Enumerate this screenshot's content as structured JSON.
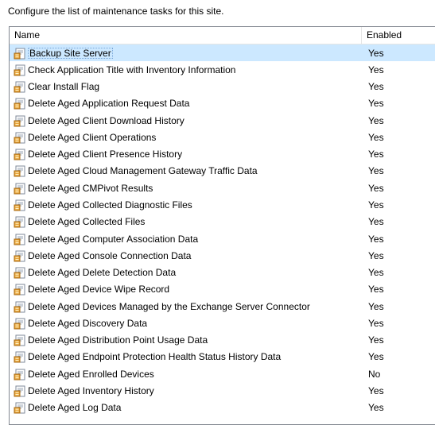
{
  "instruction": "Configure the list of maintenance tasks for this site.",
  "columns": {
    "name": "Name",
    "enabled": "Enabled"
  },
  "tasks": [
    {
      "name": "Backup Site Server",
      "enabled": "Yes",
      "selected": true
    },
    {
      "name": "Check Application Title with Inventory Information",
      "enabled": "Yes"
    },
    {
      "name": "Clear Install Flag",
      "enabled": "Yes"
    },
    {
      "name": "Delete Aged Application Request Data",
      "enabled": "Yes"
    },
    {
      "name": "Delete Aged Client Download History",
      "enabled": "Yes"
    },
    {
      "name": "Delete Aged Client Operations",
      "enabled": "Yes"
    },
    {
      "name": "Delete Aged Client Presence History",
      "enabled": "Yes"
    },
    {
      "name": "Delete Aged Cloud Management Gateway Traffic Data",
      "enabled": "Yes"
    },
    {
      "name": "Delete Aged CMPivot Results",
      "enabled": "Yes"
    },
    {
      "name": "Delete Aged Collected Diagnostic Files",
      "enabled": "Yes"
    },
    {
      "name": "Delete Aged Collected Files",
      "enabled": "Yes"
    },
    {
      "name": "Delete Aged Computer Association Data",
      "enabled": "Yes"
    },
    {
      "name": "Delete Aged Console Connection Data",
      "enabled": "Yes"
    },
    {
      "name": "Delete Aged Delete Detection Data",
      "enabled": "Yes"
    },
    {
      "name": "Delete Aged Device Wipe Record",
      "enabled": "Yes"
    },
    {
      "name": "Delete Aged Devices Managed by the Exchange Server Connector",
      "enabled": "Yes"
    },
    {
      "name": "Delete Aged Discovery Data",
      "enabled": "Yes"
    },
    {
      "name": "Delete Aged Distribution Point Usage Data",
      "enabled": "Yes"
    },
    {
      "name": "Delete Aged Endpoint Protection Health Status History Data",
      "enabled": "Yes"
    },
    {
      "name": "Delete Aged Enrolled Devices",
      "enabled": "No"
    },
    {
      "name": "Delete Aged Inventory History",
      "enabled": "Yes"
    },
    {
      "name": "Delete Aged Log Data",
      "enabled": "Yes"
    }
  ],
  "icons": {
    "task": "maintenance-task-icon"
  },
  "colors": {
    "selection": "#cce8ff",
    "border": "#828790"
  }
}
